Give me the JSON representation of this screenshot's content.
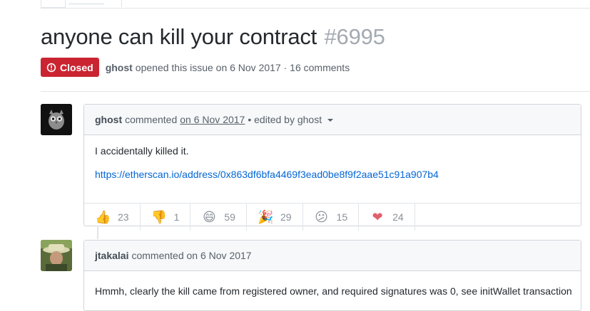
{
  "issue": {
    "title": "anyone can kill your contract",
    "number": "#6995",
    "state": "Closed",
    "author": "ghost",
    "meta_text": "opened this issue on 6 Nov 2017 · 16 comments",
    "state_color": "#cb2431"
  },
  "comments": [
    {
      "author": "ghost",
      "verb": "commented",
      "date": "on 6 Nov 2017",
      "edited": "• edited by ghost",
      "body_line1": "I accidentally killed it.",
      "link": "https://etherscan.io/address/0x863df6bfa4469f3ead0be8f9f2aae51c91a907b4",
      "reactions": [
        {
          "icon": "thumbs-up-icon",
          "glyph": "👍",
          "count": "23"
        },
        {
          "icon": "thumbs-down-icon",
          "glyph": "👎",
          "count": "1"
        },
        {
          "icon": "laugh-icon",
          "glyph": "😄",
          "count": "59"
        },
        {
          "icon": "hooray-icon",
          "glyph": "🎉",
          "count": "29"
        },
        {
          "icon": "confused-icon",
          "glyph": "😕",
          "count": "15"
        },
        {
          "icon": "heart-icon",
          "glyph": "❤",
          "count": "24"
        }
      ]
    },
    {
      "author": "jtakalai",
      "verb": "commented on 6 Nov 2017",
      "body_line1": "Hmmh, clearly the kill came from registered owner, and required signatures was 0, see initWallet transaction"
    }
  ]
}
